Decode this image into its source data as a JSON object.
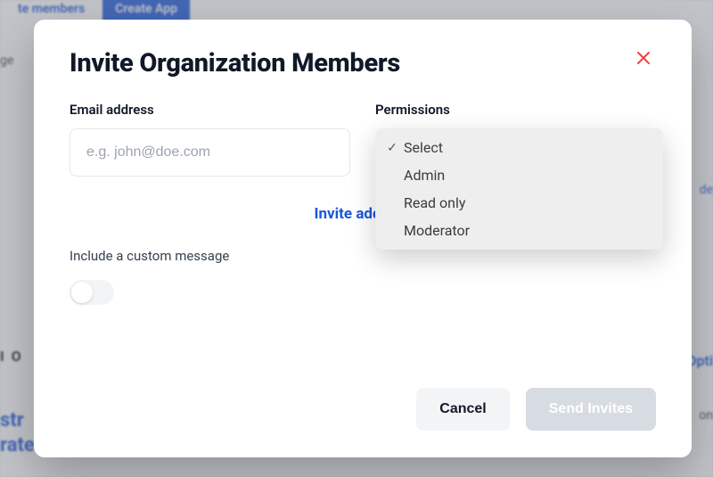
{
  "backdrop": {
    "invite_members": "te members",
    "create_app": "Create App",
    "ge": "ge",
    "io": "I O",
    "str": "str",
    "rated": "rated",
    "opti": "Opti",
    "on": "on",
    "de": "de"
  },
  "modal": {
    "title": "Invite Organization Members",
    "email_label": "Email address",
    "email_placeholder": "e.g. john@doe.com",
    "permissions_label": "Permissions",
    "invite_additional": "Invite addition",
    "custom_message_label": "Include a custom message",
    "cancel": "Cancel",
    "send": "Send Invites"
  },
  "dropdown": {
    "items": [
      {
        "label": "Select",
        "checked": true
      },
      {
        "label": "Admin",
        "checked": false
      },
      {
        "label": "Read only",
        "checked": false
      },
      {
        "label": "Moderator",
        "checked": false
      }
    ]
  }
}
